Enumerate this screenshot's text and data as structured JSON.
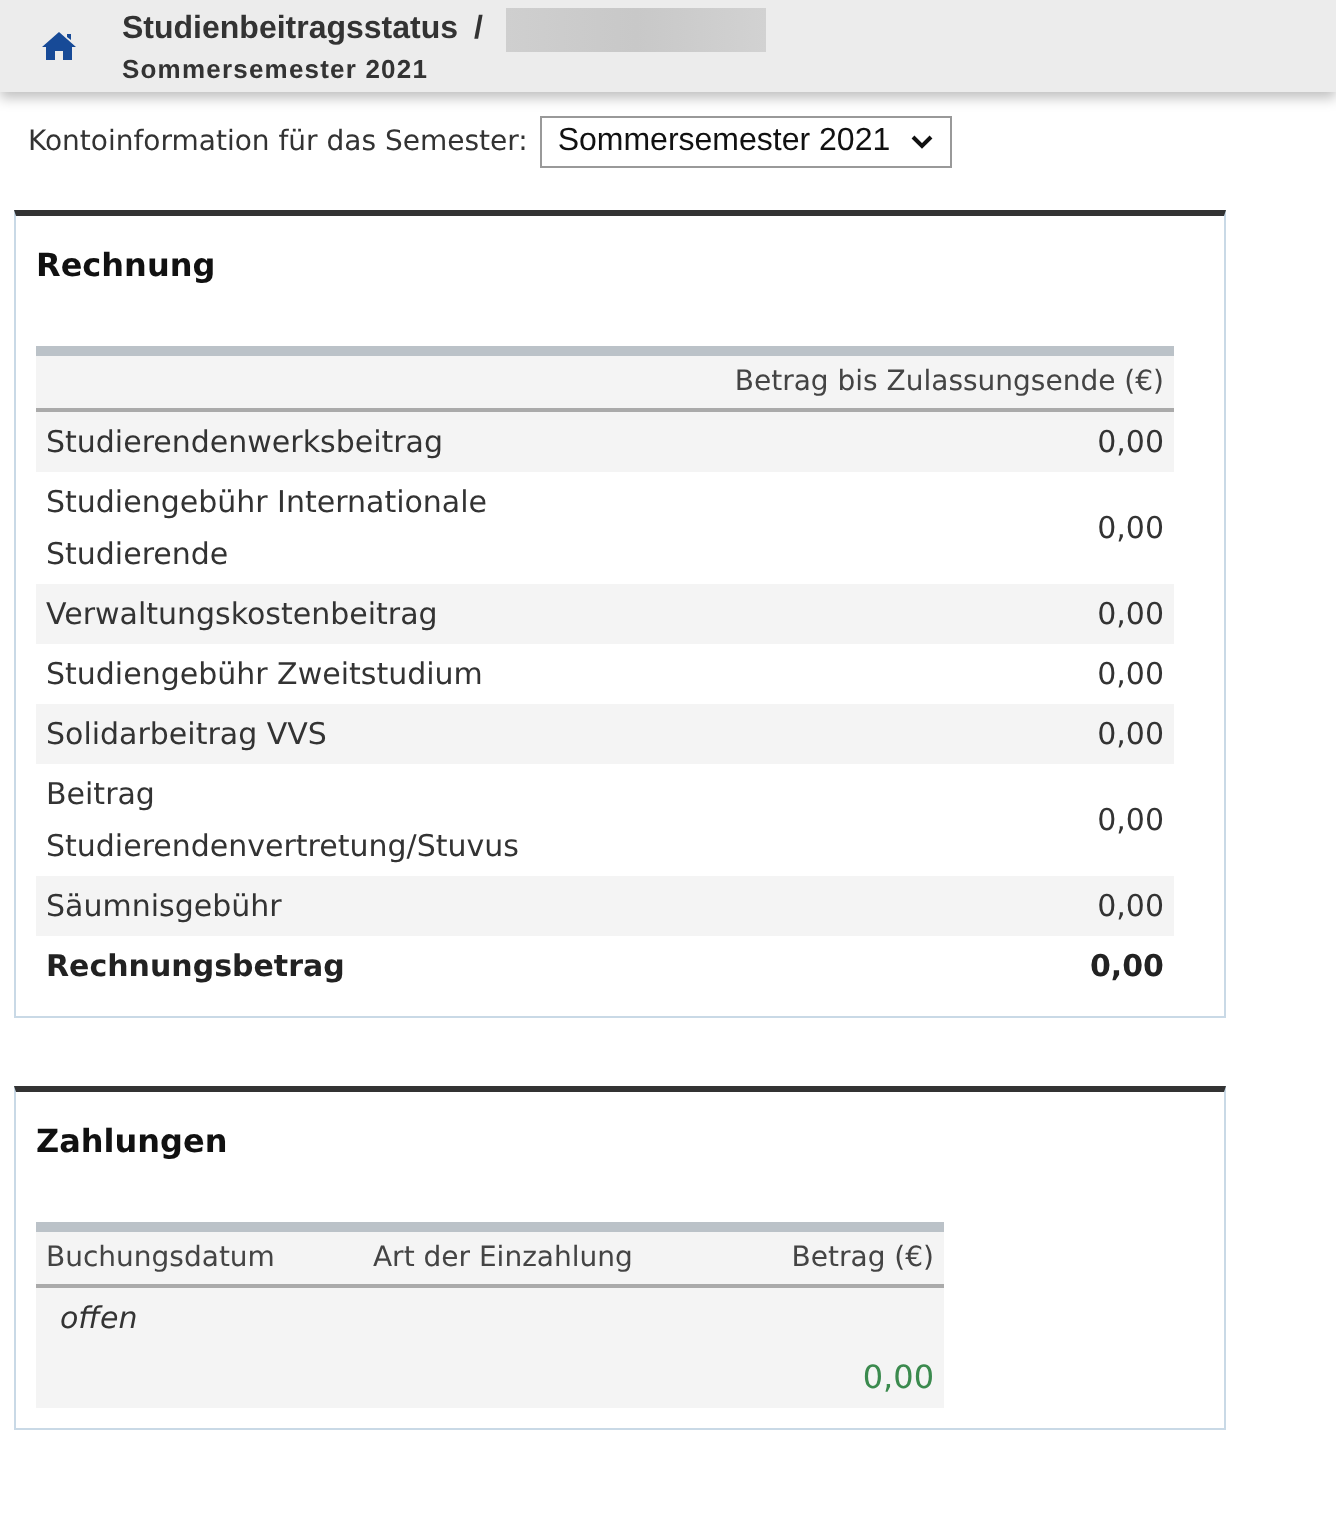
{
  "header": {
    "title": "Studienbeitragsstatus",
    "separator": "/",
    "subtitle": "Sommersemester 2021"
  },
  "semester_select": {
    "label": "Kontoinformation für das Semester:",
    "value": "Sommersemester 2021"
  },
  "invoice": {
    "title": "Rechnung",
    "columns": [
      "Betrag bis Zulassungsende (€)"
    ],
    "rows": [
      {
        "label": "Studierendenwerksbeitrag",
        "amount": "0,00"
      },
      {
        "label": "Studiengebühr Internationale Studierende",
        "amount": "0,00"
      },
      {
        "label": "Verwaltungskostenbeitrag",
        "amount": "0,00"
      },
      {
        "label": "Studiengebühr Zweitstudium",
        "amount": "0,00"
      },
      {
        "label": "Solidarbeitrag VVS",
        "amount": "0,00"
      },
      {
        "label": "Beitrag Studierendenvertretung/Stuvus",
        "amount": "0,00"
      },
      {
        "label": "Säumnisgebühr",
        "amount": "0,00"
      }
    ],
    "total": {
      "label": "Rechnungsbetrag",
      "amount": "0,00"
    }
  },
  "payments": {
    "title": "Zahlungen",
    "columns": [
      "Buchungsdatum",
      "Art der Einzahlung",
      "Betrag (€)"
    ],
    "rows": [
      {
        "kind": "group",
        "label": "offen"
      },
      {
        "kind": "sum",
        "amount": "0,00"
      }
    ]
  }
}
